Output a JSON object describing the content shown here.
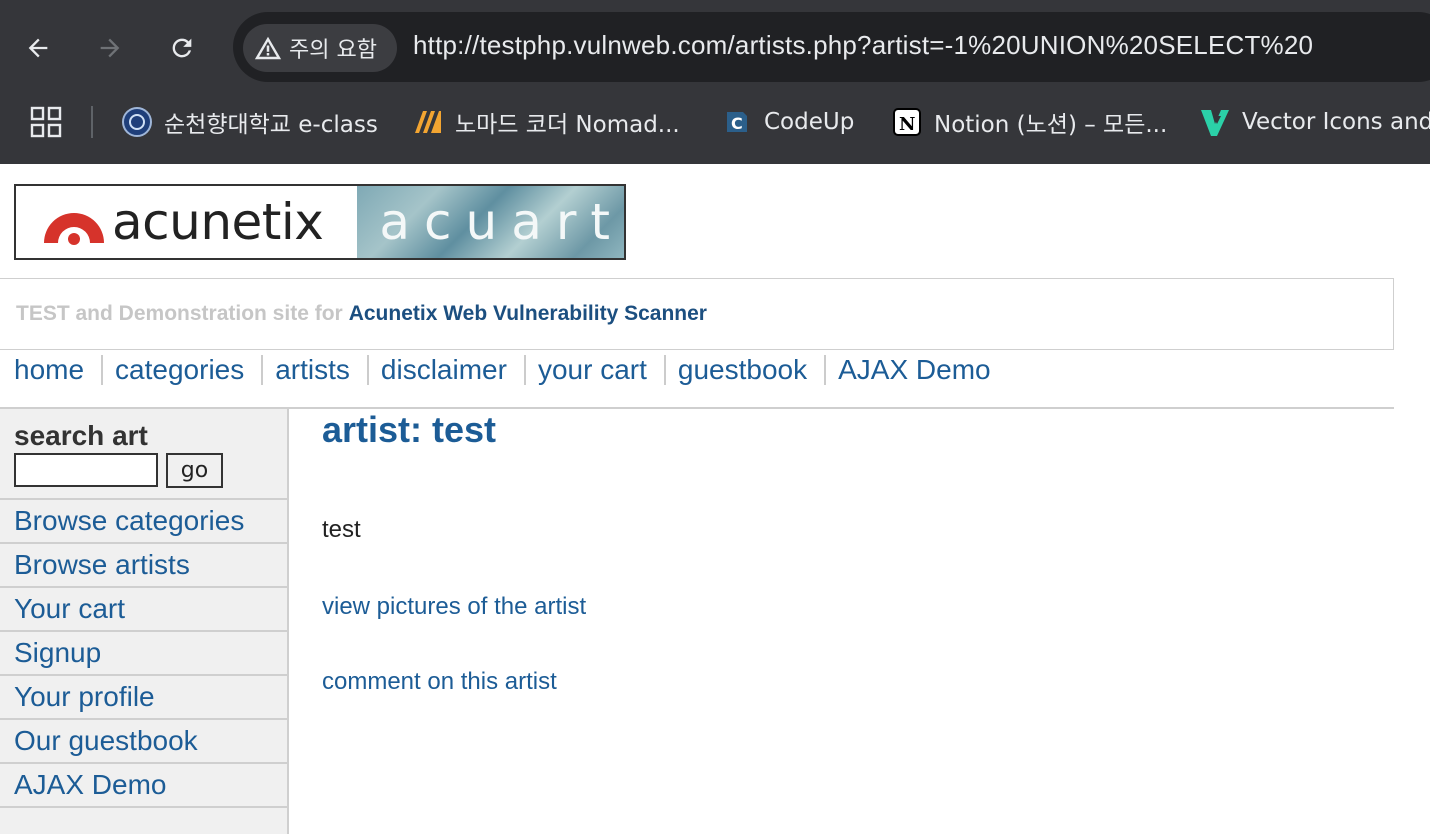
{
  "browser": {
    "security_label": "주의 요함",
    "url": "http://testphp.vulnweb.com/artists.php?artist=-1%20UNION%20SELECT%20",
    "bookmarks": [
      {
        "label": "순천향대학교 e-class",
        "icon": "soonchunhyang-logo-icon"
      },
      {
        "label": "노마드 코더 Nomad...",
        "icon": "nomad-coders-icon"
      },
      {
        "label": "CodeUp",
        "icon": "codeup-icon"
      },
      {
        "label": "Notion (노션) – 모든...",
        "icon": "notion-icon"
      },
      {
        "label": "Vector Icons and",
        "icon": "vector-icons-icon"
      }
    ]
  },
  "page": {
    "logo": {
      "brand": "acunetix",
      "product": "acuart"
    },
    "tagline": {
      "prefix": "TEST and Demonstration site for",
      "highlight": "Acunetix Web Vulnerability Scanner"
    },
    "menu": [
      "home",
      "categories",
      "artists",
      "disclaimer",
      "your cart",
      "guestbook",
      "AJAX Demo"
    ],
    "sidebar": {
      "search_title": "search art",
      "search_value": "",
      "go_label": "go",
      "items": [
        "Browse categories",
        "Browse artists",
        "Your cart",
        "Signup",
        "Your profile",
        "Our guestbook",
        "AJAX Demo"
      ]
    },
    "content": {
      "title": "artist: test",
      "description": "test",
      "links": [
        "view pictures of the artist",
        "comment on this artist"
      ]
    }
  },
  "colors": {
    "link": "#1c5c96",
    "chrome_bg": "#35363a",
    "sidebar_bg": "#f0f0f0",
    "tagline_gray": "#c6c6c6"
  }
}
